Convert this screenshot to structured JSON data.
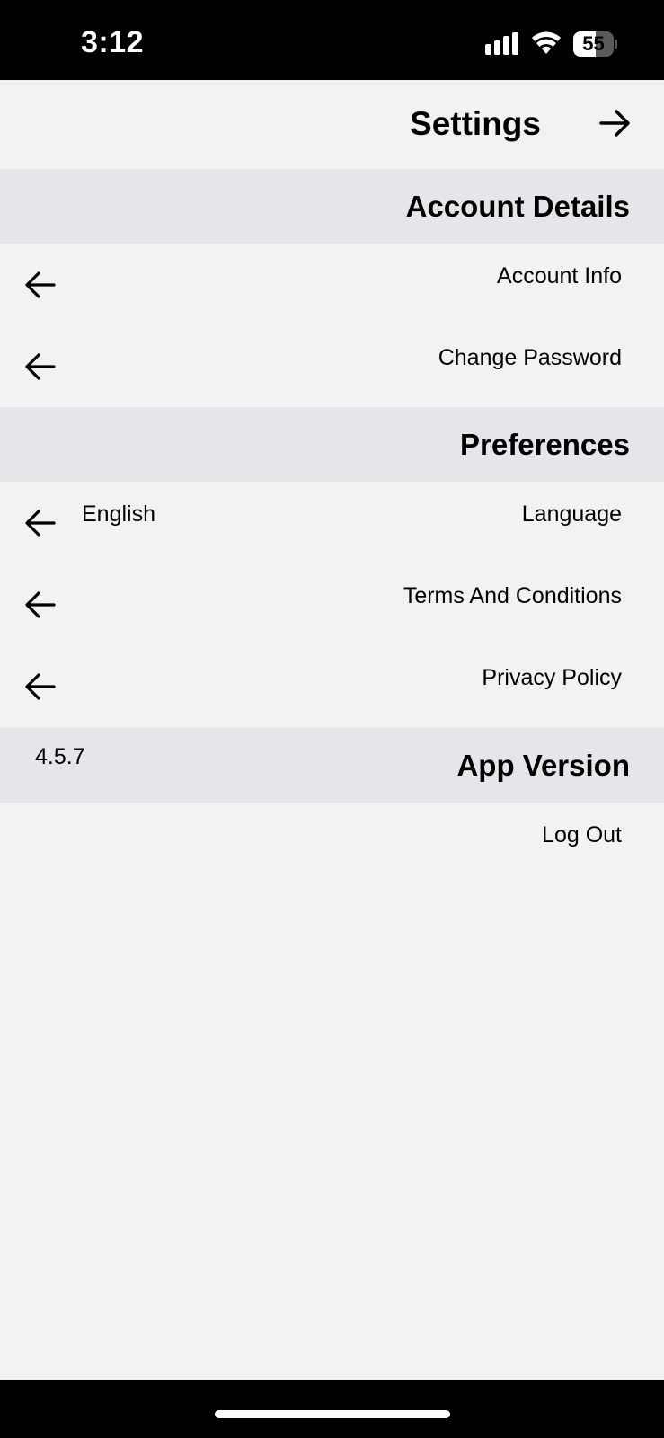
{
  "status_bar": {
    "time": "3:12",
    "battery_level": "55",
    "battery_fraction": 0.55
  },
  "header": {
    "title": "Settings",
    "forward_icon": "arrow-right-icon"
  },
  "sections": {
    "account": {
      "title": "Account Details",
      "items": [
        {
          "label": "Account Info",
          "icon": "arrow-left-icon"
        },
        {
          "label": "Change Password",
          "icon": "arrow-left-icon"
        }
      ]
    },
    "preferences": {
      "title": "Preferences",
      "items": [
        {
          "label": "Language",
          "value": "English",
          "icon": "arrow-left-icon"
        },
        {
          "label": "Terms And Conditions",
          "icon": "arrow-left-icon"
        },
        {
          "label": "Privacy Policy",
          "icon": "arrow-left-icon"
        }
      ]
    },
    "app_version": {
      "title": "App Version",
      "value": "4.5.7"
    }
  },
  "logout": {
    "label": "Log Out"
  },
  "colors": {
    "background": "#f2f2f2",
    "section_header": "#e6e6ea",
    "status_bar": "#000000",
    "text": "#000000"
  }
}
